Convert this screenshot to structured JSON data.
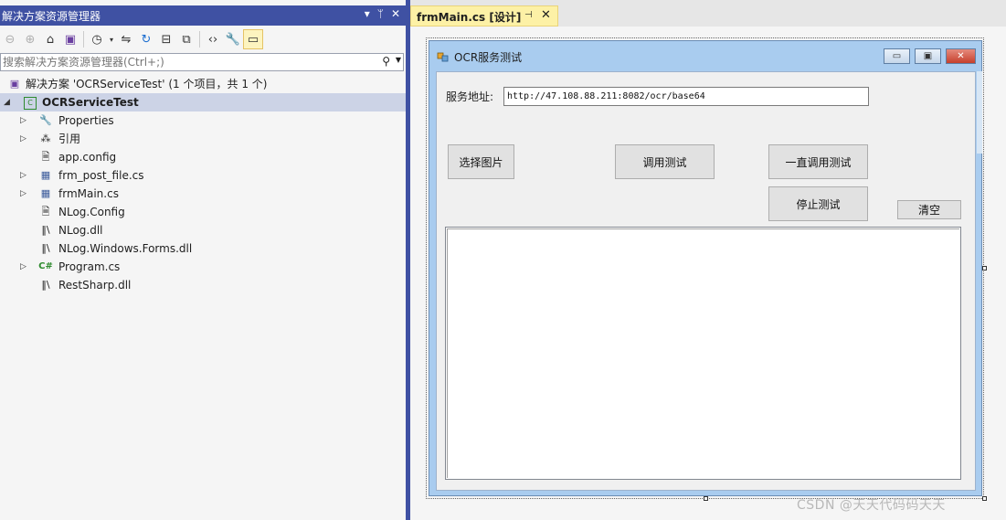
{
  "solution_explorer": {
    "title": "解决方案资源管理器",
    "title_buttons": [
      "▾",
      "ᛘ",
      "✕"
    ],
    "search_placeholder": "搜索解决方案资源管理器(Ctrl+;)",
    "solution_label": "解决方案 'OCRServiceTest' (1 个项目，共 1 个)",
    "project": "OCRServiceTest",
    "items": [
      {
        "label": "Properties",
        "icon": "wrench-icon",
        "expandable": true
      },
      {
        "label": "引用",
        "icon": "references-icon",
        "expandable": true
      },
      {
        "label": "app.config",
        "icon": "config-file-icon",
        "expandable": false
      },
      {
        "label": "frm_post_file.cs",
        "icon": "form-file-icon",
        "expandable": true
      },
      {
        "label": "frmMain.cs",
        "icon": "form-file-icon",
        "expandable": true
      },
      {
        "label": "NLog.Config",
        "icon": "config-file-icon",
        "expandable": false
      },
      {
        "label": "NLog.dll",
        "icon": "dll-icon",
        "expandable": false
      },
      {
        "label": "NLog.Windows.Forms.dll",
        "icon": "dll-icon",
        "expandable": false
      },
      {
        "label": "Program.cs",
        "icon": "csharp-file-icon",
        "expandable": true
      },
      {
        "label": "RestSharp.dll",
        "icon": "dll-icon",
        "expandable": false
      }
    ]
  },
  "designer_tab": {
    "title": "frmMain.cs [设计]",
    "pin": "⊣",
    "close": "✕"
  },
  "form": {
    "title": "OCR服务测试",
    "url_label": "服务地址:",
    "url_value": "http://47.108.88.211:8082/ocr/base64",
    "buttons": {
      "select_image": "选择图片",
      "call_test": "调用测试",
      "loop_call_test": "一直调用测试",
      "stop_test": "停止测试",
      "clear": "清空"
    },
    "caption_buttons": [
      "▭",
      "▣",
      "✕"
    ]
  },
  "watermark": "CSDN @天天代码码天天"
}
